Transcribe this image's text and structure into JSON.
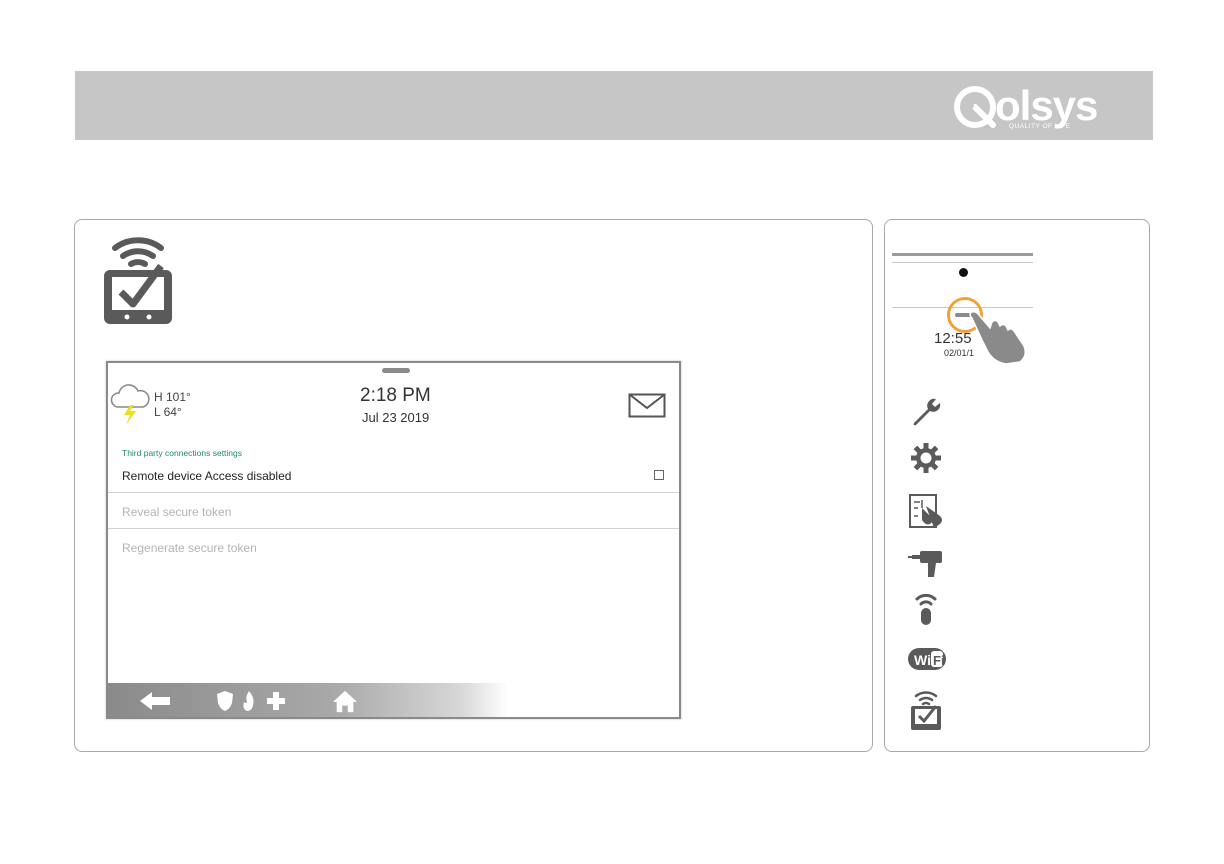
{
  "brand": {
    "name": "olsys",
    "tagline": "QUALITY OF LIFE"
  },
  "screen": {
    "weather": {
      "high": "H 101°",
      "low": "L 64°"
    },
    "time": "2:18 PM",
    "date": "Jul 23 2019",
    "section_title": "Third party connections settings",
    "rows": [
      {
        "label": "Remote device Access disabled",
        "enabled": true,
        "checked": false
      },
      {
        "label": "Reveal secure token",
        "enabled": false
      },
      {
        "label": "Regenerate secure token",
        "enabled": false
      }
    ],
    "bottom_nav": [
      "back-arrow-icon",
      "panic-icons",
      "home-icon"
    ]
  },
  "side_panel": {
    "time": "12:55",
    "date": "02/01/1",
    "icons": [
      "wrench-icon",
      "gear-icon",
      "installation-icon",
      "drill-icon",
      "remote-icon",
      "wifi-icon",
      "remote-access-icon"
    ]
  },
  "colors": {
    "header_band": "#c6c6c6",
    "accent_teal": "#1f8a6a",
    "accent_orange": "#f0a23a",
    "icon_gray": "#5a5a5a"
  }
}
